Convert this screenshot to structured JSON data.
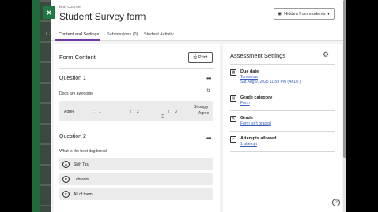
{
  "background": {
    "letter": "C"
  },
  "header": {
    "course": "test course",
    "title": "Student Survey form",
    "visibility_label": "Hidden from students",
    "close_symbol": "×"
  },
  "tabs": [
    {
      "label": "Content and Settings",
      "active": true
    },
    {
      "label": "Submissions (0)",
      "active": false
    },
    {
      "label": "Student Activity",
      "active": false
    }
  ],
  "form": {
    "heading": "Form Content",
    "print_label": "Print",
    "questions": [
      {
        "title": "Question 1",
        "text": "Dogs are awesome",
        "type": "likert",
        "scale": {
          "low": "Agree",
          "points": [
            "1",
            "2",
            "3"
          ],
          "high_line1": "Strongly",
          "high_line2": "Agree"
        }
      },
      {
        "title": "Question 2",
        "text": "What is the best dog breed",
        "type": "choice",
        "options": [
          {
            "letter": "A",
            "label": "Shih Tzu"
          },
          {
            "letter": "B",
            "label": "Labrador"
          },
          {
            "letter": "C",
            "label": "All of them"
          }
        ]
      }
    ]
  },
  "assessment_settings": {
    "heading": "Assessment Settings",
    "items": [
      {
        "label": "Due date",
        "value": "Tomorrow",
        "value2": "Sat Aug 9, 2025 11:59 PM (AKDT)",
        "icon": "calendar-icon"
      },
      {
        "label": "Grade category",
        "value": "Form",
        "icon": "category-icon"
      },
      {
        "label": "Grade",
        "value": "Form isn't graded",
        "icon": "grade-icon"
      },
      {
        "label": "Attempts allowed",
        "value": "1 attempt",
        "icon": "attempts-icon"
      }
    ]
  },
  "help": {
    "symbol": "?"
  },
  "colors": {
    "accent": "#6d3aa8",
    "close_button": "#1f7a43",
    "link": "#3b5dbd"
  }
}
